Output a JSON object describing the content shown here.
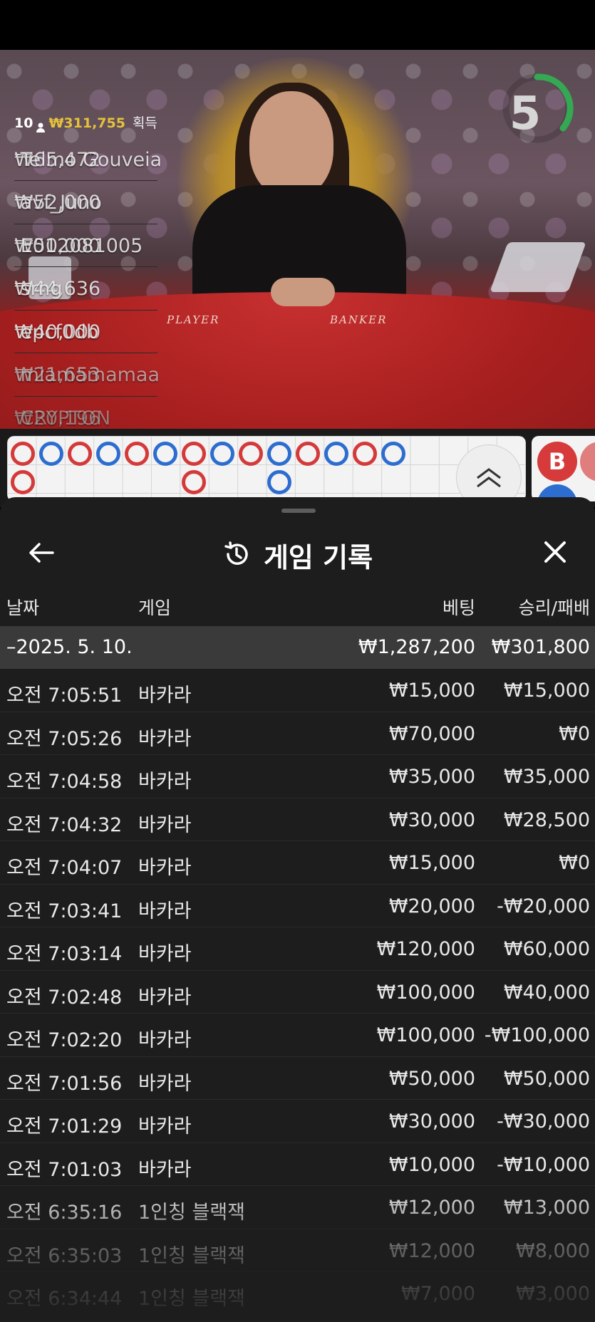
{
  "stream": {
    "winners": {
      "count": "10",
      "total": "₩311,755",
      "total_suffix": "획득",
      "list": [
        {
          "amount": "₩65,472",
          "name": "Telmo Gouveia"
        },
        {
          "amount": "₩52,000",
          "name": "avf_Juno"
        },
        {
          "amount": "₩50,000",
          "name": "E012081005"
        },
        {
          "amount": "₩44,636",
          "name": "srng"
        },
        {
          "amount": "₩40,000",
          "name": "epcf0db"
        },
        {
          "amount": "₩21,653",
          "name": "miamamamaa"
        },
        {
          "amount": "₩20,196",
          "name": "CRYPTON"
        }
      ]
    },
    "timer": "5",
    "table_player_label": "PLAYER",
    "table_banker_label": "BANKER"
  },
  "road": {
    "banker_chip_label": "B"
  },
  "history": {
    "title": "게임 기록",
    "columns": {
      "date": "날짜",
      "game": "게임",
      "bet": "베팅",
      "result": "승리/패배"
    },
    "day": {
      "label": "–2025. 5. 10.",
      "bet_total": "₩1,287,200",
      "result_total": "₩301,800"
    },
    "rows": [
      {
        "time": "오전 7:05:51",
        "game": "바카라",
        "bet": "₩15,000",
        "result": "₩15,000"
      },
      {
        "time": "오전 7:05:26",
        "game": "바카라",
        "bet": "₩70,000",
        "result": "₩0"
      },
      {
        "time": "오전 7:04:58",
        "game": "바카라",
        "bet": "₩35,000",
        "result": "₩35,000"
      },
      {
        "time": "오전 7:04:32",
        "game": "바카라",
        "bet": "₩30,000",
        "result": "₩28,500"
      },
      {
        "time": "오전 7:04:07",
        "game": "바카라",
        "bet": "₩15,000",
        "result": "₩0"
      },
      {
        "time": "오전 7:03:41",
        "game": "바카라",
        "bet": "₩20,000",
        "result": "-₩20,000"
      },
      {
        "time": "오전 7:03:14",
        "game": "바카라",
        "bet": "₩120,000",
        "result": "₩60,000"
      },
      {
        "time": "오전 7:02:48",
        "game": "바카라",
        "bet": "₩100,000",
        "result": "₩40,000"
      },
      {
        "time": "오전 7:02:20",
        "game": "바카라",
        "bet": "₩100,000",
        "result": "-₩100,000"
      },
      {
        "time": "오전 7:01:56",
        "game": "바카라",
        "bet": "₩50,000",
        "result": "₩50,000"
      },
      {
        "time": "오전 7:01:29",
        "game": "바카라",
        "bet": "₩30,000",
        "result": "-₩30,000"
      },
      {
        "time": "오전 7:01:03",
        "game": "바카라",
        "bet": "₩10,000",
        "result": "-₩10,000"
      },
      {
        "time": "오전 6:35:16",
        "game": "1인칭 블랙잭",
        "bet": "₩12,000",
        "result": "₩13,000"
      },
      {
        "time": "오전 6:35:03",
        "game": "1인칭 블랙잭",
        "bet": "₩12,000",
        "result": "₩8,000"
      },
      {
        "time": "오전 6:34:44",
        "game": "1인칭 블랙잭",
        "bet": "₩7,000",
        "result": "₩3,000"
      }
    ]
  }
}
